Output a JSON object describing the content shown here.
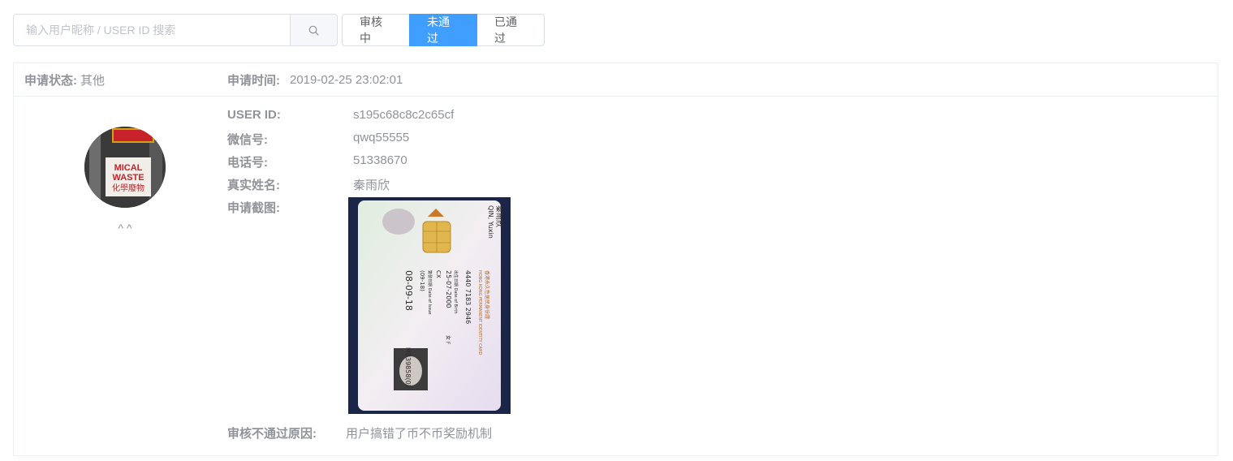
{
  "search": {
    "placeholder": "输入用户昵称 / USER ID 搜索",
    "value": "",
    "icon": "search-icon"
  },
  "tabs": [
    {
      "label": "审核中",
      "active": false
    },
    {
      "label": "未通过",
      "active": true
    },
    {
      "label": "已通过",
      "active": false
    }
  ],
  "colors": {
    "accent": "#409eff",
    "border": "#dcdfe6",
    "label": "#909399"
  },
  "record": {
    "status_label": "申请状态:",
    "status_value": "其他",
    "time_label": "申请时间:",
    "time_value": "2019-02-25 23:02:01",
    "nickname": "^ ^",
    "avatar_sign": {
      "line1": "MICAL",
      "line2": "WASTE",
      "line3": "化學廢物"
    },
    "fields": [
      {
        "label": "USER ID:",
        "value": "s195c68c8c2c65cf"
      },
      {
        "label": "微信号:",
        "value": "qwq55555"
      },
      {
        "label": "电话号:",
        "value": "51338670"
      },
      {
        "label": "真实姓名:",
        "value": "秦雨欣"
      }
    ],
    "screenshot_label": "申请截图:",
    "id_card": {
      "name_cn": "秦雨欣",
      "name_en": "QIN, Yuxin",
      "title_cn": "香港永久性居民身份證",
      "title_en": "HONG KONG PERMANENT IDENTITY CARD",
      "code": "4440 7183 2946",
      "dob_label": "出生日期 Date of Birth",
      "dob": "25-07-2000",
      "sex": "女 F",
      "symbols": "CX",
      "issue_label": "簽發日期 Date of Issue",
      "issue_short": "(09-18)",
      "issue": "08-09-18",
      "number": "M839858(0)"
    },
    "reason_label": "审核不通过原因:",
    "reason_value": "用户搞错了币不币奖励机制"
  }
}
